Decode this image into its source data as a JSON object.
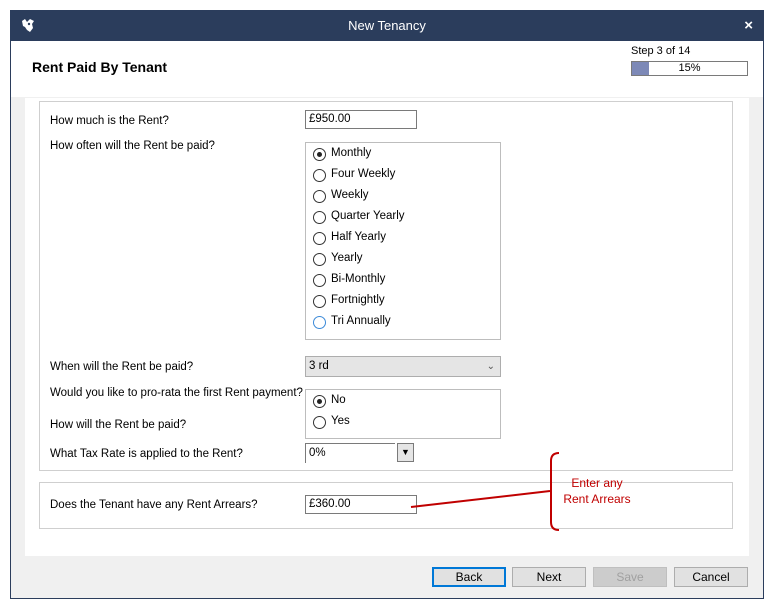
{
  "window": {
    "title": "New Tenancy",
    "close_glyph": "×",
    "app_icon": "horse-head-icon"
  },
  "header": {
    "heading": "Rent Paid By Tenant",
    "step_text": "Step 3 of 14",
    "progress_label": "15%",
    "progress_fraction": 0.15
  },
  "form": {
    "rent_question": "How much is the Rent?",
    "rent_value": "£950.00",
    "frequency_question": "How often will the Rent be paid?",
    "frequency_options": [
      "Monthly",
      "Four Weekly",
      "Weekly",
      "Quarter Yearly",
      "Half Yearly",
      "Yearly",
      "Bi-Monthly",
      "Fortnightly",
      "Tri Annually"
    ],
    "frequency_selected": "Monthly",
    "when_question": "When will the Rent be paid?",
    "when_value": "3 rd",
    "prorata_question": "Would you like to pro-rata  the first Rent payment?",
    "prorata_options": [
      "No",
      "Yes"
    ],
    "prorata_selected": "No",
    "how_question": "How will the Rent be paid?",
    "tax_question": "What Tax Rate is applied to the Rent?",
    "tax_value": "0%",
    "arrears_question": "Does the Tenant have any Rent Arrears?",
    "arrears_value": "£360.00"
  },
  "annotation": {
    "line1": "Enter any",
    "line2": "Rent Arrears",
    "color": "#c00000"
  },
  "buttons": {
    "back": "Back",
    "next": "Next",
    "save": "Save",
    "cancel": "Cancel"
  },
  "colors": {
    "titlebar": "#2b3d5c",
    "progress_fill": "#7d89b7",
    "accent": "#0078d7"
  }
}
